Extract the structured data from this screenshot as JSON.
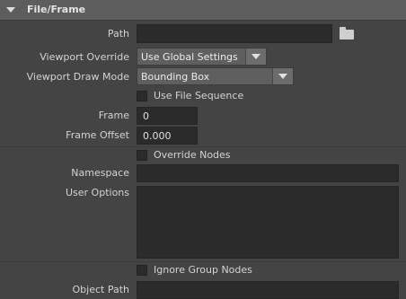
{
  "section": {
    "title": "File/Frame"
  },
  "path": {
    "label": "Path",
    "value": ""
  },
  "viewport_override": {
    "label": "Viewport Override",
    "value": "Use Global Settings"
  },
  "viewport_draw_mode": {
    "label": "Viewport Draw Mode",
    "value": "Bounding Box"
  },
  "use_file_sequence": {
    "label": "Use File Sequence",
    "checked": false
  },
  "frame": {
    "label": "Frame",
    "value": "0"
  },
  "frame_offset": {
    "label": "Frame Offset",
    "value": "0.000"
  },
  "override_nodes": {
    "label": "Override Nodes",
    "checked": false
  },
  "namespace": {
    "label": "Namespace",
    "value": ""
  },
  "user_options": {
    "label": "User Options",
    "value": ""
  },
  "ignore_group_nodes": {
    "label": "Ignore Group Nodes",
    "checked": false
  },
  "object_path": {
    "label": "Object Path",
    "value": ""
  },
  "icons": {
    "browse": "folder-icon",
    "collapse": "triangle-down-icon"
  }
}
